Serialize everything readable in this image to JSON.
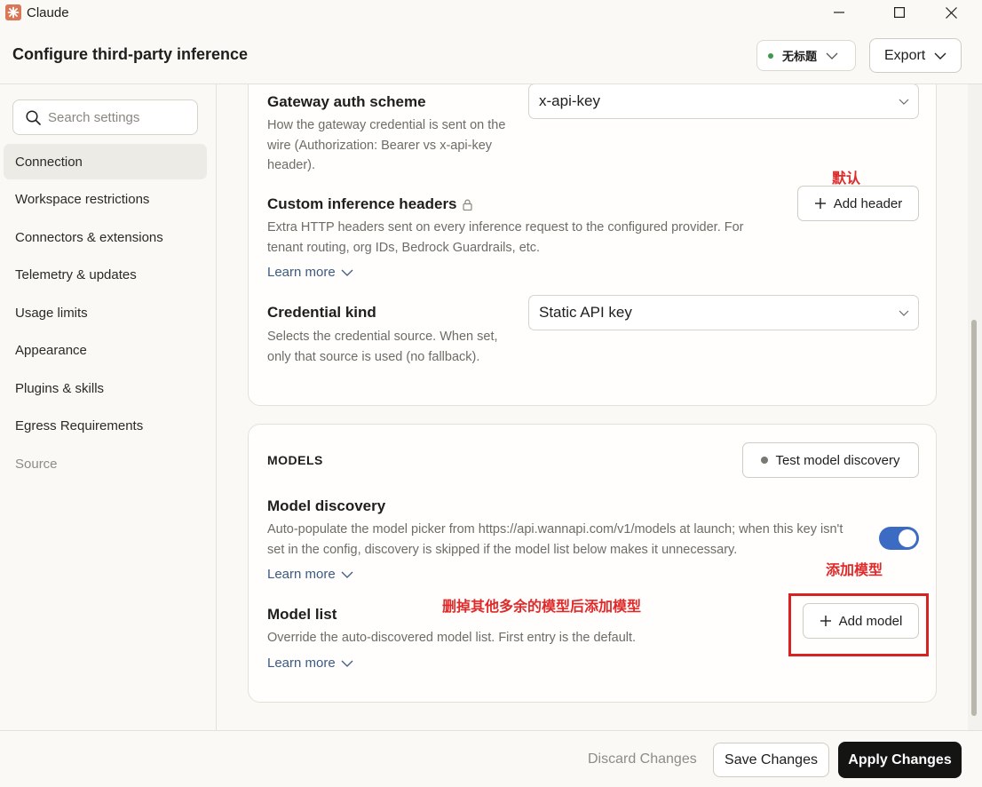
{
  "window": {
    "app_name": "Claude",
    "title": "Configure third-party inference"
  },
  "header": {
    "profile_label": "无标题",
    "profile_status_color": "#3d9a4a",
    "export_label": "Export"
  },
  "sidebar": {
    "search_placeholder": "Search settings",
    "items": [
      {
        "label": "Connection",
        "active": true
      },
      {
        "label": "Workspace restrictions"
      },
      {
        "label": "Connectors & extensions"
      },
      {
        "label": "Telemetry & updates"
      },
      {
        "label": "Usage limits"
      },
      {
        "label": "Appearance"
      },
      {
        "label": "Plugins & skills"
      },
      {
        "label": "Egress Requirements"
      },
      {
        "label": "Source",
        "muted": true
      }
    ]
  },
  "connection": {
    "gateway_auth": {
      "title": "Gateway auth scheme",
      "desc": "How the gateway credential is sent on the wire (Authorization: Bearer vs x-api-key header).",
      "value": "x-api-key"
    },
    "custom_headers": {
      "title": "Custom inference headers",
      "desc": "Extra HTTP headers sent on every inference request to the configured provider. For tenant routing, org IDs, Bedrock Guardrails, etc.",
      "learn_more": "Learn more",
      "button": "Add header"
    },
    "credential_kind": {
      "title": "Credential kind",
      "desc": "Selects the credential source. When set, only that source is used (no fallback).",
      "value": "Static API key"
    }
  },
  "models": {
    "section_label": "MODELS",
    "test_button": "Test model discovery",
    "discovery": {
      "title": "Model discovery",
      "desc": "Auto-populate the model picker from https://api.wannapi.com/v1/models at launch; when this key isn't set in the config, discovery is skipped if the model list below makes it unnecessary.",
      "learn_more": "Learn more",
      "enabled": true
    },
    "model_list": {
      "title": "Model list",
      "desc": "Override the auto-discovered model list. First entry is the default.",
      "learn_more": "Learn more",
      "button": "Add model"
    }
  },
  "annotations": {
    "default_note": "默认",
    "add_model_note": "添加模型",
    "delete_note": "删掉其他多余的模型后添加模型",
    "color": "#e02a2a"
  },
  "footer": {
    "discard": "Discard Changes",
    "save": "Save Changes",
    "apply": "Apply Changes"
  }
}
